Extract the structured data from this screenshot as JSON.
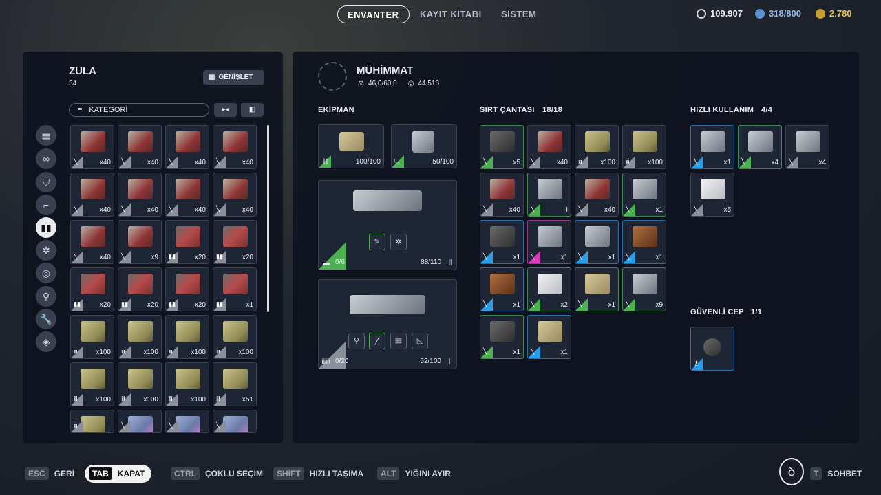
{
  "tabs": [
    {
      "label": "ENVANTER"
    },
    {
      "label": "KAYIT KİTABI"
    },
    {
      "label": "SİSTEM"
    }
  ],
  "currency": {
    "credits": "109.907",
    "storage": "318/800",
    "gold": "2.780"
  },
  "stash": {
    "title": "ZULA",
    "count": "34",
    "expand_label": "GENİŞLET",
    "category_label": "KATEGORİ"
  },
  "loadout": {
    "title": "MÜHİMMAT",
    "weight": "46,0/60,0",
    "value": "44.518"
  },
  "sections": {
    "equipment": "EKİPMAN",
    "backpack": "SIRT ÇANTASI",
    "backpack_count": "18/18",
    "quick": "HIZLI KULLANIM",
    "quick_count": "4/4",
    "safe": "GÜVENLİ CEP",
    "safe_count": "1/1"
  },
  "equipment": {
    "armor_durability": "100/100",
    "shield_durability": "50/100",
    "weapon1_ammo": "0/6",
    "weapon1_durability": "88/110",
    "weapon2_ammo": "0/20",
    "weapon2_durability": "52/100"
  },
  "stash_items": [
    {
      "q": "x40",
      "a": "ammo"
    },
    {
      "q": "x40",
      "a": "ammo"
    },
    {
      "q": "x40",
      "a": "ammo"
    },
    {
      "q": "x40",
      "a": "ammo"
    },
    {
      "q": "x40",
      "a": "ammo"
    },
    {
      "q": "x40",
      "a": "ammo"
    },
    {
      "q": "x40",
      "a": "ammo"
    },
    {
      "q": "x40",
      "a": "ammo"
    },
    {
      "q": "x40",
      "a": "ammo"
    },
    {
      "q": "x9",
      "a": "ammo"
    },
    {
      "q": "x20",
      "a": "shell"
    },
    {
      "q": "x20",
      "a": "shell"
    },
    {
      "q": "x20",
      "a": "shell"
    },
    {
      "q": "x20",
      "a": "shell"
    },
    {
      "q": "x20",
      "a": "shell"
    },
    {
      "q": "x1",
      "a": "shell"
    },
    {
      "q": "x100",
      "a": "gold"
    },
    {
      "q": "x100",
      "a": "gold"
    },
    {
      "q": "x100",
      "a": "gold"
    },
    {
      "q": "x100",
      "a": "gold"
    },
    {
      "q": "x100",
      "a": "gold"
    },
    {
      "q": "x100",
      "a": "gold"
    },
    {
      "q": "x100",
      "a": "gold"
    },
    {
      "q": "x51",
      "a": "gold"
    },
    {
      "q": "",
      "a": "gold"
    },
    {
      "q": "",
      "a": "blue"
    },
    {
      "q": "",
      "a": "blue"
    },
    {
      "q": "",
      "a": "blue"
    }
  ],
  "backpack_items": [
    {
      "q": "x5",
      "a": "dark",
      "c": "green"
    },
    {
      "q": "x40",
      "a": "ammo",
      "c": "grey"
    },
    {
      "q": "x100",
      "a": "gold",
      "c": "grey"
    },
    {
      "q": "x100",
      "a": "gold",
      "c": "grey"
    },
    {
      "q": "x40",
      "a": "ammo",
      "c": "grey"
    },
    {
      "q": "I",
      "a": "metal",
      "c": "green"
    },
    {
      "q": "x40",
      "a": "ammo",
      "c": "grey"
    },
    {
      "q": "x1",
      "a": "metal",
      "c": "green"
    },
    {
      "q": "x1",
      "a": "dark",
      "c": "blue"
    },
    {
      "q": "x1",
      "a": "metal",
      "c": "pink"
    },
    {
      "q": "x1",
      "a": "metal",
      "c": "blue"
    },
    {
      "q": "x1",
      "a": "brown",
      "c": "blue"
    },
    {
      "q": "x1",
      "a": "brown",
      "c": "blue"
    },
    {
      "q": "x2",
      "a": "white",
      "c": "green"
    },
    {
      "q": "x1",
      "a": "beige",
      "c": "green"
    },
    {
      "q": "x9",
      "a": "metal",
      "c": "green"
    },
    {
      "q": "x1",
      "a": "dark",
      "c": "green"
    },
    {
      "q": "x1",
      "a": "beige",
      "c": "blue"
    }
  ],
  "quick_items": [
    {
      "q": "x1",
      "a": "metal",
      "c": "blue"
    },
    {
      "q": "x4",
      "a": "metal",
      "c": "green"
    },
    {
      "q": "x4",
      "a": "metal",
      "c": "grey"
    },
    {
      "q": "x5",
      "a": "white",
      "c": "grey"
    }
  ],
  "footer": [
    {
      "key": "ESC",
      "label": "GERİ"
    },
    {
      "key": "TAB",
      "label": "KAPAT"
    },
    {
      "key": "CTRL",
      "label": "ÇOKLU SEÇİM"
    },
    {
      "key": "SHİFT",
      "label": "HIZLI TAŞIMA"
    },
    {
      "key": "ALT",
      "label": "YIĞINI AYIR"
    },
    {
      "key": "T",
      "label": "SOHBET"
    }
  ]
}
